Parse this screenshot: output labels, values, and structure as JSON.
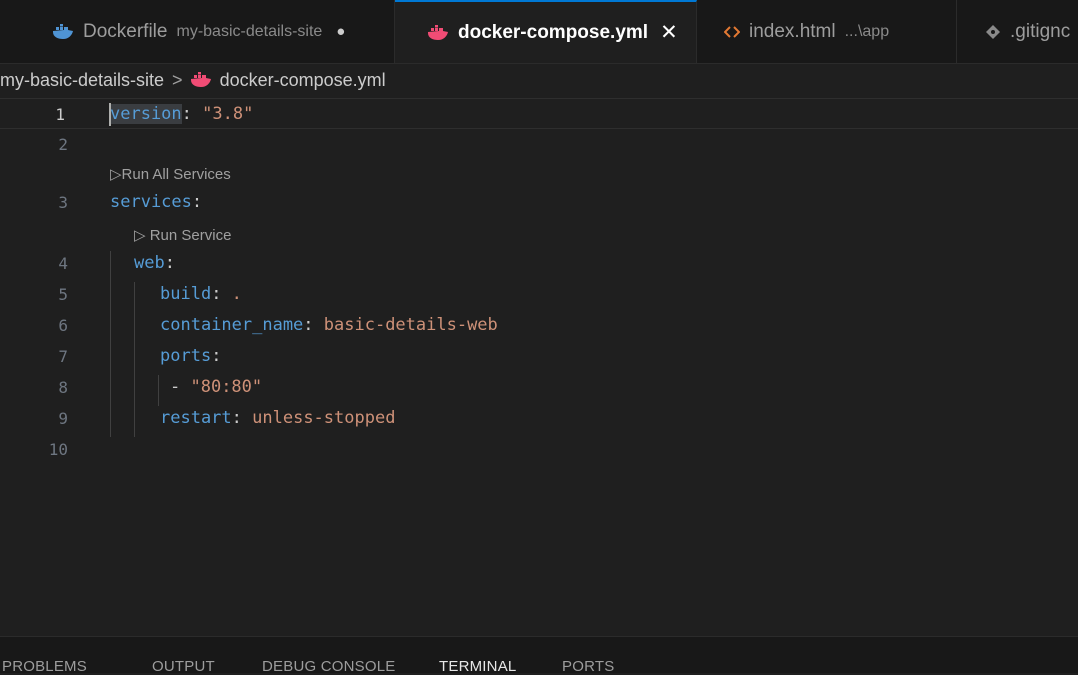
{
  "tabs": [
    {
      "label": "Dockerfile",
      "description": "my-basic-details-site",
      "dirty_marker": "●",
      "icon": "docker-whale-icon",
      "active": false
    },
    {
      "label": "docker-compose.yml",
      "close_marker": "✕",
      "icon": "docker-whale-icon",
      "active": true
    },
    {
      "label": "index.html",
      "description": "...\\app",
      "icon": "html-icon",
      "active": false
    },
    {
      "label": ".gitignc",
      "icon": "git-icon",
      "active": false
    }
  ],
  "breadcrumb": {
    "folder": "my-basic-details-site",
    "separator": ">",
    "file": "docker-compose.yml"
  },
  "editor": {
    "line_numbers": [
      "1",
      "2",
      "3",
      "4",
      "5",
      "6",
      "7",
      "8",
      "9",
      "10"
    ],
    "code": {
      "l1_key": "version",
      "l1_colon": ": ",
      "l1_value": "\"3.8\"",
      "l3_key": "services",
      "l3_colon": ":",
      "l4_key": "web",
      "l4_colon": ":",
      "l5_key": "build",
      "l5_colon": ": ",
      "l5_value": ".",
      "l6_key": "container_name",
      "l6_colon": ": ",
      "l6_value": "basic-details-web",
      "l7_key": "ports",
      "l7_colon": ":",
      "l8_dash": "- ",
      "l8_value": "\"80:80\"",
      "l9_key": "restart",
      "l9_colon": ": ",
      "l9_value": "unless-stopped"
    },
    "codelens": {
      "run_all": "▷Run All Services",
      "run_service": "▷ Run Service"
    }
  },
  "panel": {
    "tabs": [
      "PROBLEMS",
      "OUTPUT",
      "DEBUG CONSOLE",
      "TERMINAL",
      "PORTS"
    ],
    "active_tab": "TERMINAL"
  },
  "colors": {
    "background": "#1f1f1f",
    "key": "#569cd6",
    "string": "#ce9178",
    "docker_icon_active": "#f14c75",
    "docker_icon_inactive": "#4f94d4",
    "html_icon": "#e37933",
    "active_tab_border": "#0078d4"
  }
}
